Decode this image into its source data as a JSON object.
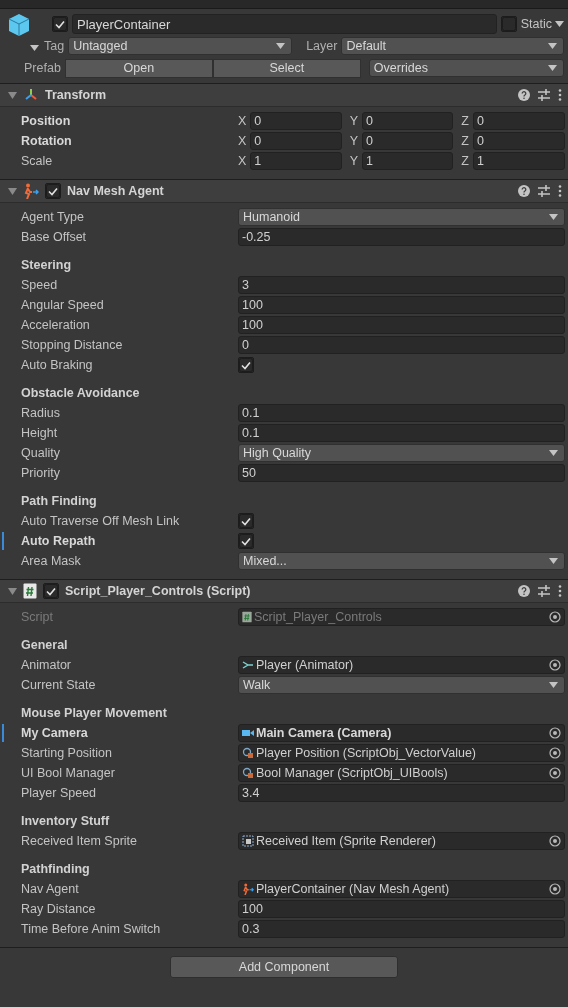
{
  "object": {
    "active": true,
    "name": "PlayerContainer",
    "static": false,
    "static_label": "Static",
    "tag_label": "Tag",
    "tag": "Untagged",
    "layer_label": "Layer",
    "layer": "Default",
    "prefab_label": "Prefab",
    "prefab_buttons": [
      "Open",
      "Select"
    ],
    "overrides": "Overrides"
  },
  "components": [
    {
      "kind": "transform",
      "title": "Transform",
      "expanded": true,
      "rows": [
        {
          "kind": "vector3",
          "label": "Position",
          "bold": true,
          "values": [
            {
              "axis": "X",
              "value": "0"
            },
            {
              "axis": "Y",
              "value": "0"
            },
            {
              "axis": "Z",
              "value": "0"
            }
          ]
        },
        {
          "kind": "vector3",
          "label": "Rotation",
          "bold": true,
          "values": [
            {
              "axis": "X",
              "value": "0"
            },
            {
              "axis": "Y",
              "value": "0"
            },
            {
              "axis": "Z",
              "value": "0"
            }
          ]
        },
        {
          "kind": "vector3",
          "label": "Scale",
          "bold": false,
          "values": [
            {
              "axis": "X",
              "value": "1"
            },
            {
              "axis": "Y",
              "value": "1"
            },
            {
              "axis": "Z",
              "value": "1"
            }
          ]
        }
      ]
    },
    {
      "kind": "navmesh",
      "title": "Nav Mesh Agent",
      "enabled": true,
      "expanded": true,
      "rows": [
        {
          "kind": "dropdown",
          "label": "Agent Type",
          "value": "Humanoid"
        },
        {
          "kind": "text",
          "label": "Base Offset",
          "value": "-0.25"
        },
        {
          "kind": "section",
          "label": "Steering"
        },
        {
          "kind": "text",
          "label": "Speed",
          "value": "3"
        },
        {
          "kind": "text",
          "label": "Angular Speed",
          "value": "100"
        },
        {
          "kind": "text",
          "label": "Acceleration",
          "value": "100"
        },
        {
          "kind": "text",
          "label": "Stopping Distance",
          "value": "0"
        },
        {
          "kind": "checkbox",
          "label": "Auto Braking",
          "checked": true
        },
        {
          "kind": "section",
          "label": "Obstacle Avoidance"
        },
        {
          "kind": "text",
          "label": "Radius",
          "value": "0.1"
        },
        {
          "kind": "text",
          "label": "Height",
          "value": "0.1"
        },
        {
          "kind": "dropdown",
          "label": "Quality",
          "value": "High Quality"
        },
        {
          "kind": "text",
          "label": "Priority",
          "value": "50"
        },
        {
          "kind": "section",
          "label": "Path Finding"
        },
        {
          "kind": "checkbox",
          "label": "Auto Traverse Off Mesh Link",
          "checked": true
        },
        {
          "kind": "checkbox",
          "label": "Auto Repath",
          "checked": true,
          "modified": true
        },
        {
          "kind": "dropdown",
          "label": "Area Mask",
          "value": "Mixed..."
        }
      ]
    },
    {
      "kind": "script",
      "title": "Script_Player_Controls (Script)",
      "enabled": true,
      "expanded": true,
      "rows": [
        {
          "kind": "scriptref",
          "label": "Script",
          "value": "Script_Player_Controls",
          "disabled": true
        },
        {
          "kind": "section",
          "label": "General"
        },
        {
          "kind": "animatorref",
          "label": "Animator",
          "value": "Player (Animator)"
        },
        {
          "kind": "dropdown",
          "label": "Current State",
          "value": "Walk"
        },
        {
          "kind": "section",
          "label": "Mouse Player Movement"
        },
        {
          "kind": "cameraref",
          "label": "My Camera",
          "value": "Main Camera (Camera)",
          "modified": true
        },
        {
          "kind": "assetref",
          "label": "Starting Position",
          "value": "Player Position (ScriptObj_VectorValue)"
        },
        {
          "kind": "assetref",
          "label": "UI Bool Manager",
          "value": "Bool Manager (ScriptObj_UIBools)"
        },
        {
          "kind": "text",
          "label": "Player Speed",
          "value": "3.4"
        },
        {
          "kind": "section",
          "label": "Inventory Stuff"
        },
        {
          "kind": "spriteref",
          "label": "Received Item Sprite",
          "value": "Received Item (Sprite Renderer)"
        },
        {
          "kind": "section",
          "label": "Pathfinding"
        },
        {
          "kind": "agentref",
          "label": "Nav Agent",
          "value": "PlayerContainer (Nav Mesh Agent)"
        },
        {
          "kind": "text",
          "label": "Ray Distance",
          "value": "100"
        },
        {
          "kind": "text",
          "label": "Time Before Anim Switch",
          "value": "0.3"
        }
      ]
    }
  ],
  "add_component": "Add Component"
}
